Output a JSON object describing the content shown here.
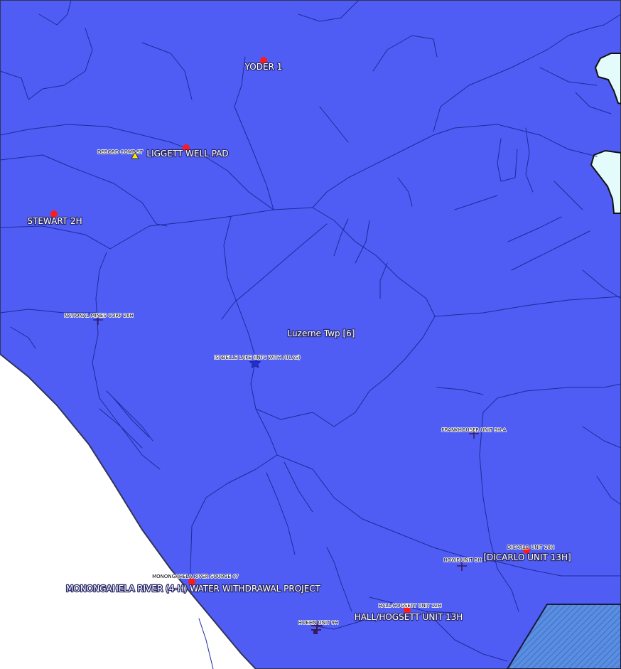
{
  "map": {
    "colors": {
      "township_fill": "#4f5df5",
      "outside_fill": "#ffffff",
      "water_fill": "#e3fbfb",
      "roads": "#1f2a9a",
      "boundary": "#333355",
      "well_marker": "#ff1a1a",
      "cross_marker": "#3a1a5a",
      "hatch_fill": "#5a8ee0"
    },
    "township_label": "Luzerne Twp [6]",
    "wells": [
      {
        "id": "yoder",
        "label": "YODER 1"
      },
      {
        "id": "liggett",
        "label": "LIGGETT WELL PAD"
      },
      {
        "id": "stewart",
        "label": "STEWART 2H"
      },
      {
        "id": "dicarlo",
        "label": "[DICARLO UNIT 13H]"
      },
      {
        "id": "monongahela",
        "label": "MONONGAHELA RIVER (4-H) WATER WITHDRAWAL PROJECT"
      },
      {
        "id": "hallhogsett",
        "label": "HALL/HOGSETT UNIT 13H"
      }
    ],
    "small_labels": [
      {
        "id": "debord",
        "label": "DEBORD COMP ST"
      },
      {
        "id": "nationalmines",
        "label": "NATIONAL MINES CORP 26H"
      },
      {
        "id": "isabelle",
        "label": "ISABELLE LAKE (INTC WITH ATLAS)"
      },
      {
        "id": "frankhouser",
        "label": "FRANKHOUSER UNIT 3H-A"
      },
      {
        "id": "dicarlo18",
        "label": "DICARLO UNIT 18H"
      },
      {
        "id": "howe",
        "label": "HOWE UNIT 5H"
      },
      {
        "id": "monsource",
        "label": "MONONGAHELA RIVER SOURCE 47"
      },
      {
        "id": "hallhogsett12",
        "label": "HALL-HOGSETT UNIT 12H"
      },
      {
        "id": "hoehn",
        "label": "HOEHN UNIT 9H"
      }
    ]
  }
}
